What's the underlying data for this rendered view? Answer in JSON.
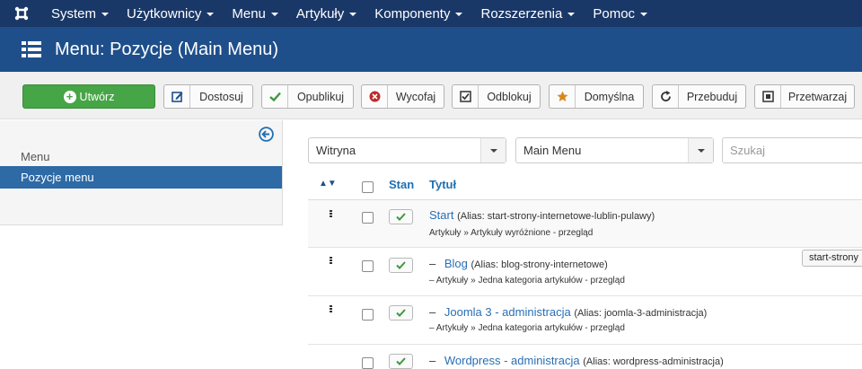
{
  "nav": {
    "items": [
      "System",
      "Użytkownicy",
      "Menu",
      "Artykuły",
      "Komponenty",
      "Rozszerzenia",
      "Pomoc"
    ]
  },
  "header": {
    "title": "Menu: Pozycje (Main Menu)"
  },
  "toolbar": {
    "create": "Utwórz",
    "edit": "Dostosuj",
    "publish": "Opublikuj",
    "unpublish": "Wycofaj",
    "checkin": "Odblokuj",
    "default": "Domyślna",
    "rebuild": "Przebuduj",
    "batch": "Przetwarzaj"
  },
  "sidebar": {
    "heading": "Menu",
    "active_item": "Pozycje menu"
  },
  "filters": {
    "client": "Witryna",
    "menu": "Main Menu",
    "search_placeholder": "Szukaj"
  },
  "table": {
    "col_state": "Stan",
    "col_title": "Tytuł",
    "rows": [
      {
        "prefix": "",
        "title": "Start",
        "alias": "(Alias: start-strony-internetowe-lublin-pulawy)",
        "type": "Artykuły » Artykuły wyróżnione - przegląd"
      },
      {
        "prefix": "–",
        "title": "Blog",
        "alias": "(Alias: blog-strony-internetowe)",
        "type": "Artykuły » Jedna kategoria artykułów - przegląd"
      },
      {
        "prefix": "–",
        "title": "Joomla 3 - administracja",
        "alias": "(Alias: joomla-3-administracja)",
        "type": "Artykuły » Jedna kategoria artykułów - przegląd"
      },
      {
        "prefix": "–",
        "title": "Wordpress - administracja",
        "alias": "(Alias: wordpress-administracja)",
        "type": ""
      }
    ]
  },
  "tooltip": {
    "text": "start-strony"
  },
  "colors": {
    "nav": "#1a3867",
    "header": "#1f4f8a",
    "create": "#46a546",
    "sidebar_active": "#2d6aa6",
    "link": "#2a6eb5"
  }
}
